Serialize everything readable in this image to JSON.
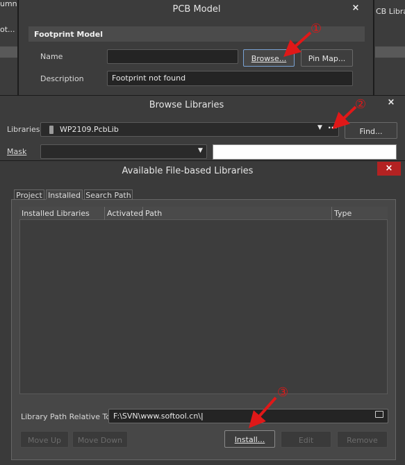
{
  "background": {
    "left_fragment_top": "umn",
    "left_fragment_mid": "ot...",
    "right_fragment": "CB Libra"
  },
  "pcb_model": {
    "title": "PCB Model",
    "close": "×",
    "section": "Footprint Model",
    "name_label": "Name",
    "name_value": "",
    "browse_button": "Browse...",
    "pinmap_button": "Pin Map...",
    "description_label": "Description",
    "description_value": "Footprint not found"
  },
  "browse_libraries": {
    "title": "Browse Libraries",
    "close": "×",
    "libraries_label": "Libraries",
    "library_selected": "WP2109.PcbLib",
    "more_button": "···",
    "find_button": "Find...",
    "mask_label": "Mask",
    "mask_value": ""
  },
  "available_libraries": {
    "title": "Available File-based Libraries",
    "close": "×",
    "tabs": [
      "Project",
      "Installed",
      "Search Path"
    ],
    "active_tab": "Installed",
    "columns": [
      "Installed Libraries",
      "Activated",
      "Path",
      "Type"
    ],
    "rows": [],
    "relative_label": "Library Path Relative To:",
    "relative_value": "F:\\SVN\\www.softool.cn\\",
    "buttons": {
      "move_up": "Move Up",
      "move_down": "Move Down",
      "install": "Install...",
      "edit": "Edit",
      "remove": "Remove"
    }
  },
  "annotations": {
    "marker1": "①",
    "marker2": "②",
    "marker3": "③",
    "color": "#e01818"
  },
  "icons": {
    "close": "close-icon",
    "dropdown": "chevron-down-icon",
    "library_file": "library-file-icon",
    "folder": "folder-open-icon"
  }
}
